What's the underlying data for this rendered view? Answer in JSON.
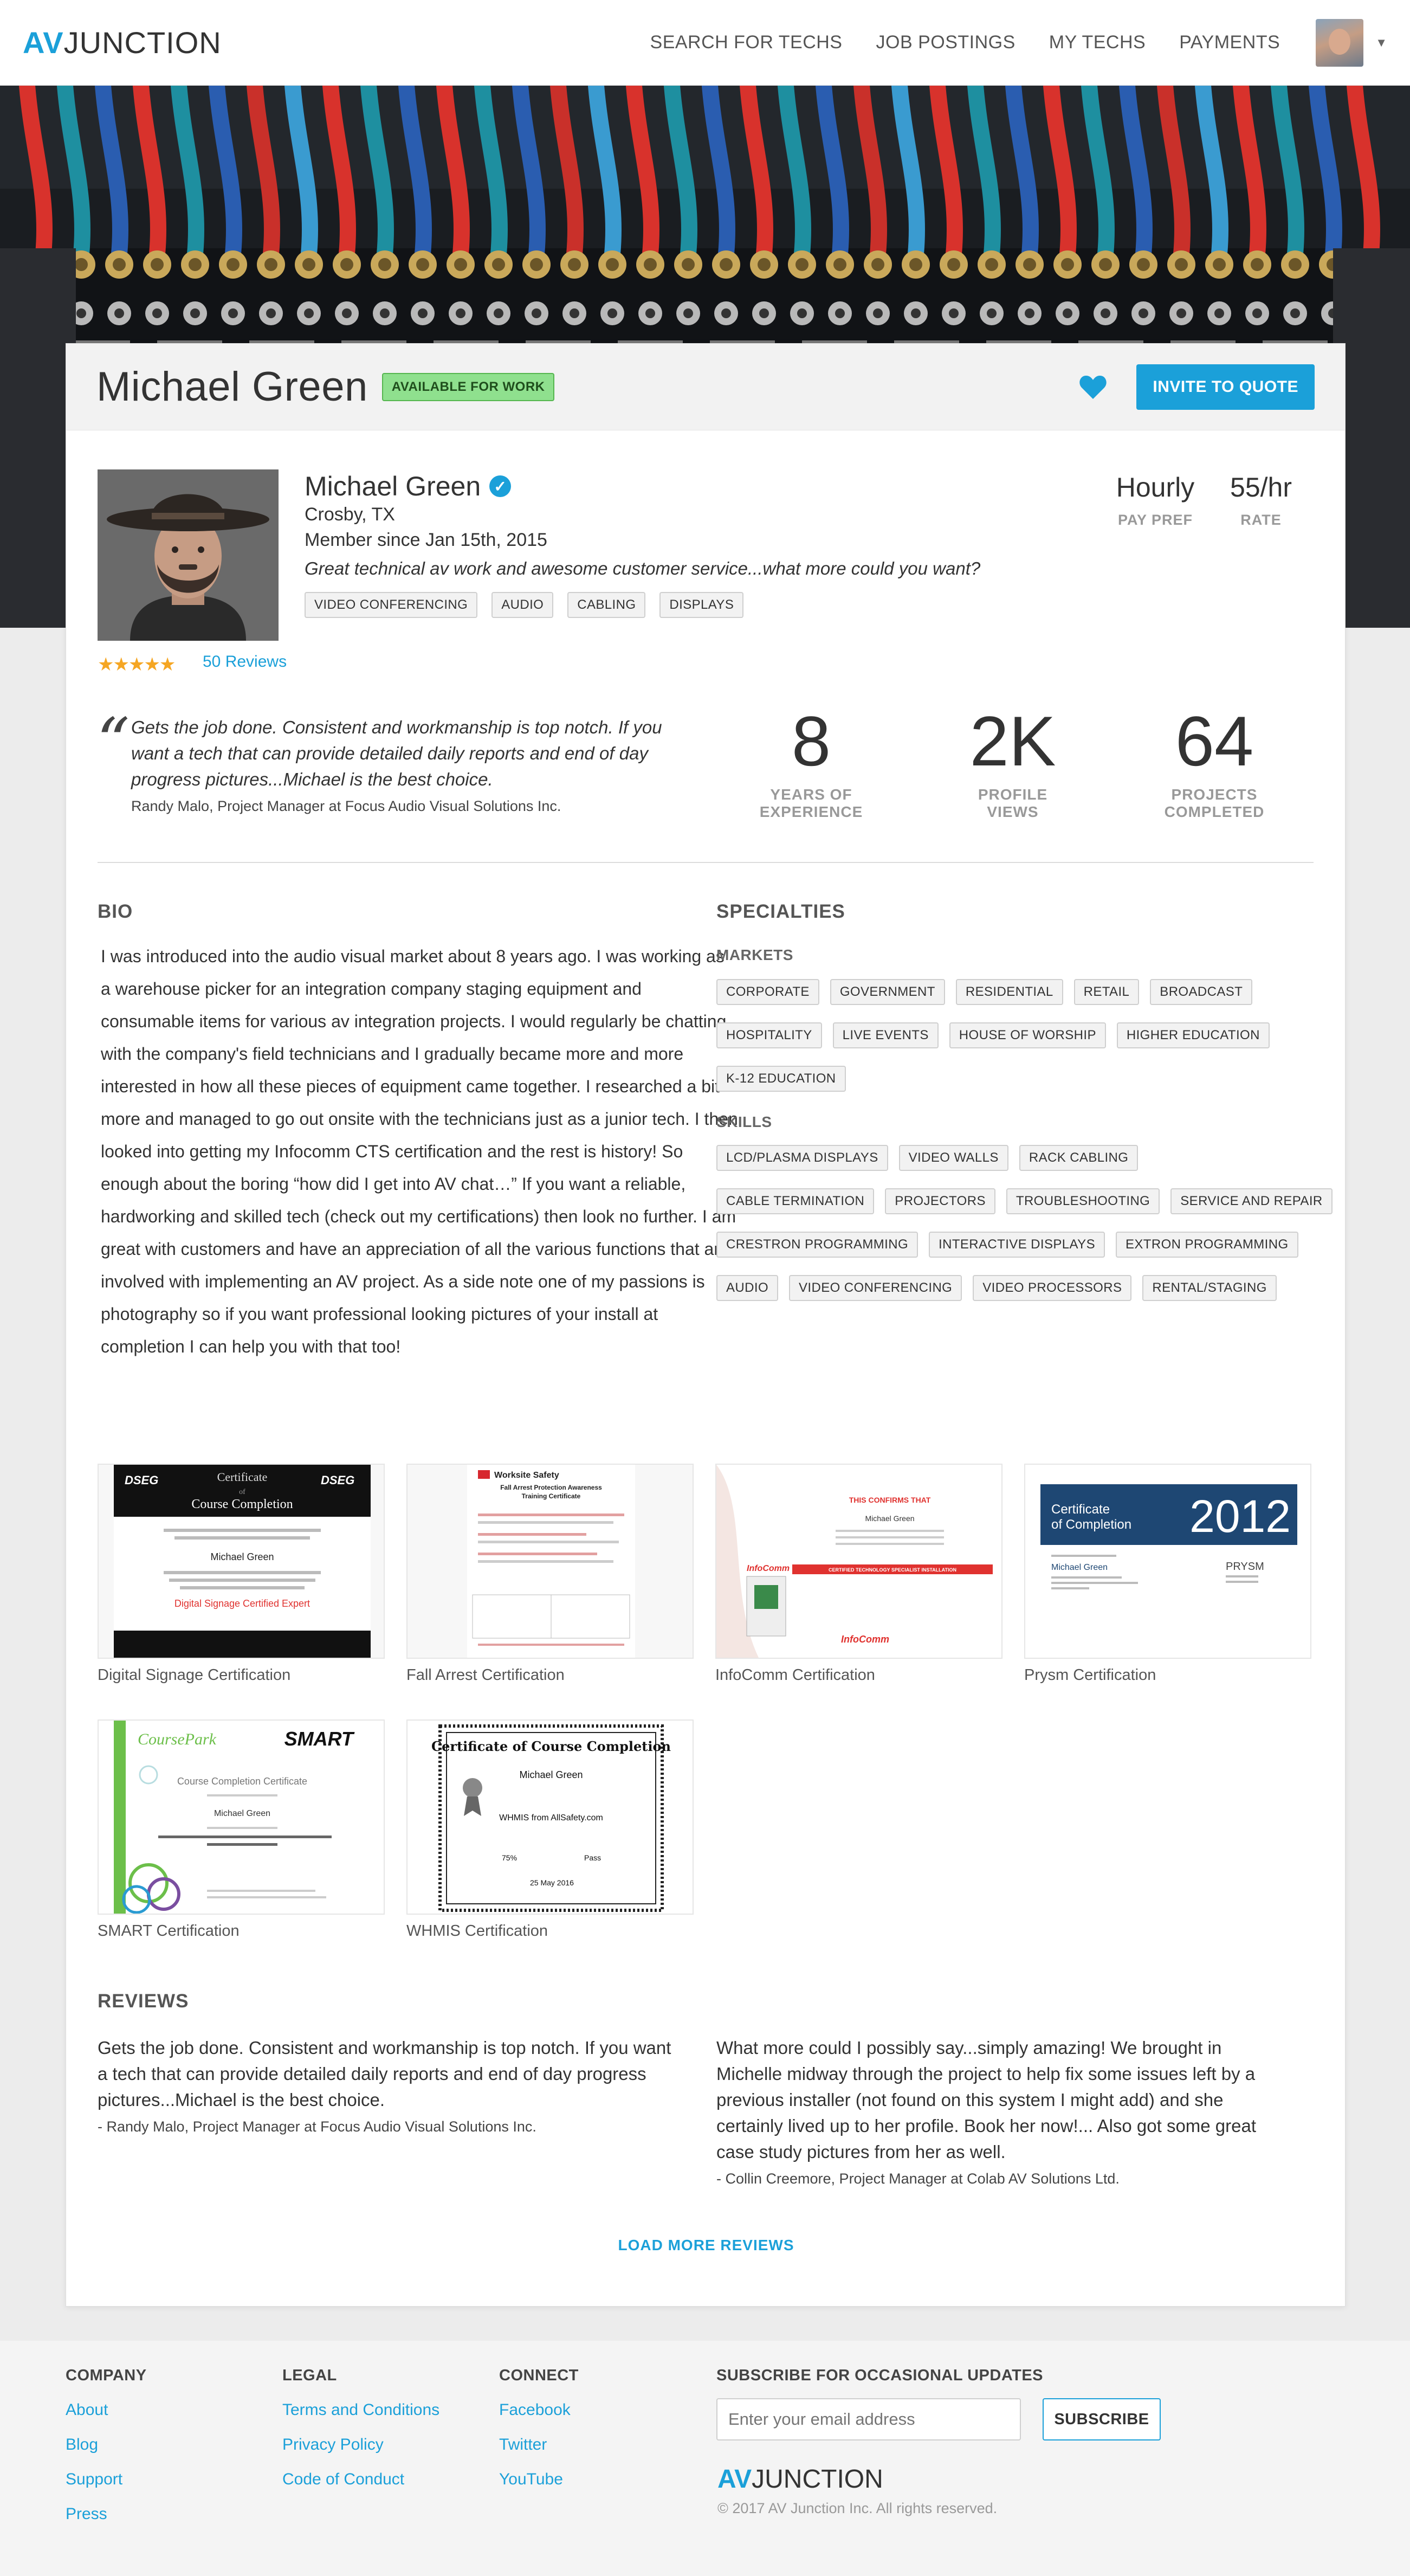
{
  "nav": {
    "logo_accent": "AV",
    "logo_rest": "JUNCTION",
    "links": [
      "SEARCH FOR TECHS",
      "JOB POSTINGS",
      "MY TECHS",
      "PAYMENTS"
    ]
  },
  "header": {
    "name": "Michael Green",
    "badge": "AVAILABLE FOR WORK",
    "invite_label": "INVITE TO QUOTE"
  },
  "profile": {
    "name": "Michael Green",
    "location": "Crosby, TX",
    "member_since": "Member since  Jan 15th, 2015",
    "tagline": "Great technical av work and awesome customer service...what more could you want?",
    "tags": [
      "VIDEO CONFERENCING",
      "AUDIO",
      "CABLING",
      "DISPLAYS"
    ],
    "rating": 4.5,
    "reviews_link": "50 Reviews",
    "pay_pref": {
      "value": "Hourly",
      "label": "PAY PREF"
    },
    "rate": {
      "value": "55/hr",
      "label": "RATE"
    }
  },
  "featured_review": {
    "text": "Gets the job done. Consistent and workmanship is top notch.  If you want a tech that can provide detailed daily reports and end of day progress pictures...Michael is the best choice.",
    "author": "Randy Malo,  Project Manager at Focus Audio Visual Solutions Inc."
  },
  "stats": [
    {
      "value": "8",
      "label_1": "YEARS OF",
      "label_2": "EXPERIENCE"
    },
    {
      "value": "2K",
      "label_1": "PROFILE",
      "label_2": "VIEWS"
    },
    {
      "value": "64",
      "label_1": "PROJECTS",
      "label_2": "COMPLETED"
    }
  ],
  "bio": {
    "title": "BIO",
    "text": "I was introduced into the audio visual market about 8 years ago.  I was working as a warehouse picker for an integration company staging equipment and consumable items for various av integration projects.  I would regularly be chatting with the company's field technicians and I gradually became more and more interested in how all these pieces of equipment came together.  I researched a bit more and managed to go out onsite with the technicians just as a junior tech.  I then looked into getting my Infocomm CTS certification and the rest is history!  So enough about the boring “how did I get into AV chat…” If you want a reliable, hardworking and skilled tech (check out my certifications) then look no further.  I am great with customers and have an appreciation of all the various functions that are involved with implementing an AV project.  As a side note one of my passions is photography so if you want professional looking pictures of your install at completion I can help you with that too!"
  },
  "specialties": {
    "title": "SPECIALTIES",
    "markets_title": "MARKETS",
    "markets": [
      [
        "CORPORATE",
        "GOVERNMENT",
        "RESIDENTIAL",
        "RETAIL",
        "BROADCAST"
      ],
      [
        "HOSPITALITY",
        "LIVE EVENTS",
        "HOUSE OF WORSHIP",
        "HIGHER EDUCATION"
      ],
      [
        "K-12 EDUCATION"
      ]
    ],
    "skills_title": "SKILLS",
    "skills": [
      [
        "LCD/PLASMA DISPLAYS",
        "VIDEO WALLS",
        "RACK CABLING"
      ],
      [
        "CABLE TERMINATION",
        "PROJECTORS",
        "TROUBLESHOOTING",
        "SERVICE AND REPAIR"
      ],
      [
        "CRESTRON PROGRAMMING",
        "INTERACTIVE DISPLAYS",
        "EXTRON PROGRAMMING"
      ],
      [
        "AUDIO",
        "VIDEO CONFERENCING",
        "VIDEO PROCESSORS",
        "RENTAL/STAGING"
      ]
    ]
  },
  "certifications": [
    {
      "caption": "Digital Signage Certification",
      "doc": {
        "brand": "DSEG",
        "title_1": "Certificate",
        "title_2": "of",
        "title_3": "Course Completion",
        "name": "Michael Green",
        "award": "Digital Signage Certified Expert"
      }
    },
    {
      "caption": "Fall Arrest Certification",
      "doc": {
        "brand": "Worksite Safety",
        "title_1": "Fall Arrest Protection Awareness",
        "title_2": "Training Certificate"
      }
    },
    {
      "caption": "InfoComm Certification",
      "doc": {
        "brand": "InfoComm",
        "title_1": "THIS CONFIRMS THAT",
        "name": "Michael Green",
        "award": "CERTIFIED TECHNOLOGY SPECIALIST INSTALLATION"
      }
    },
    {
      "caption": "Prysm Certification",
      "doc": {
        "brand": "PRYSM",
        "title_1": "Certificate",
        "title_2": "of Completion",
        "year": "2012",
        "name": "Michael Green"
      }
    },
    {
      "caption": "SMART Certification",
      "doc": {
        "brand": "CoursePark",
        "brand_2": "SMART",
        "title_1": "Course Completion Certificate",
        "name": "Michael Green"
      }
    },
    {
      "caption": "WHMIS Certification",
      "doc": {
        "title_1": "Certificate of Course Completion",
        "name": "Michael Green",
        "course": "WHMIS from AllSafety.com",
        "score": "75%",
        "grade": "Pass",
        "date": "25 May 2016"
      }
    }
  ],
  "reviews": {
    "title": "REVIEWS",
    "items": [
      {
        "text": "Gets the job done. Consistent and workmanship is top notch.  If you want a tech that can provide detailed daily reports and end of day progress pictures...Michael is the best choice.",
        "author": "- Randy Malo,  Project Manager at Focus Audio Visual Solutions Inc."
      },
      {
        "text": "What more could I possibly say...simply amazing!  We brought in Michelle midway through the project to help fix some issues left by a previous installer (not found on this system I might add) and she certainly lived up to her profile.  Book her now!... Also got some great case study pictures from her as well.",
        "author": "- Collin Creemore,  Project Manager at Colab AV Solutions Ltd."
      }
    ],
    "load_more": "LOAD MORE REVIEWS"
  },
  "footer": {
    "company": {
      "title": "COMPANY",
      "links": [
        "About",
        "Blog",
        "Support",
        "Press"
      ]
    },
    "legal": {
      "title": "LEGAL",
      "links": [
        "Terms and Conditions",
        "Privacy Policy",
        "Code of Conduct"
      ]
    },
    "connect": {
      "title": "CONNECT",
      "links": [
        "Facebook",
        "Twitter",
        "YouTube"
      ]
    },
    "subscribe": {
      "title": "SUBSCRIBE FOR OCCASIONAL UPDATES",
      "placeholder": "Enter your email address",
      "button": "SUBSCRIBE"
    },
    "logo_accent": "AV",
    "logo_rest": "JUNCTION",
    "copyright": "© 2017 AV Junction Inc. All rights reserved."
  },
  "colors": {
    "accent": "#1ba0d9",
    "available": "#8fe08e",
    "star": "#f5a623"
  },
  "icons": [
    "heart-icon",
    "verified-check-icon",
    "star-icon",
    "quote-icon",
    "chevron-down-icon"
  ]
}
